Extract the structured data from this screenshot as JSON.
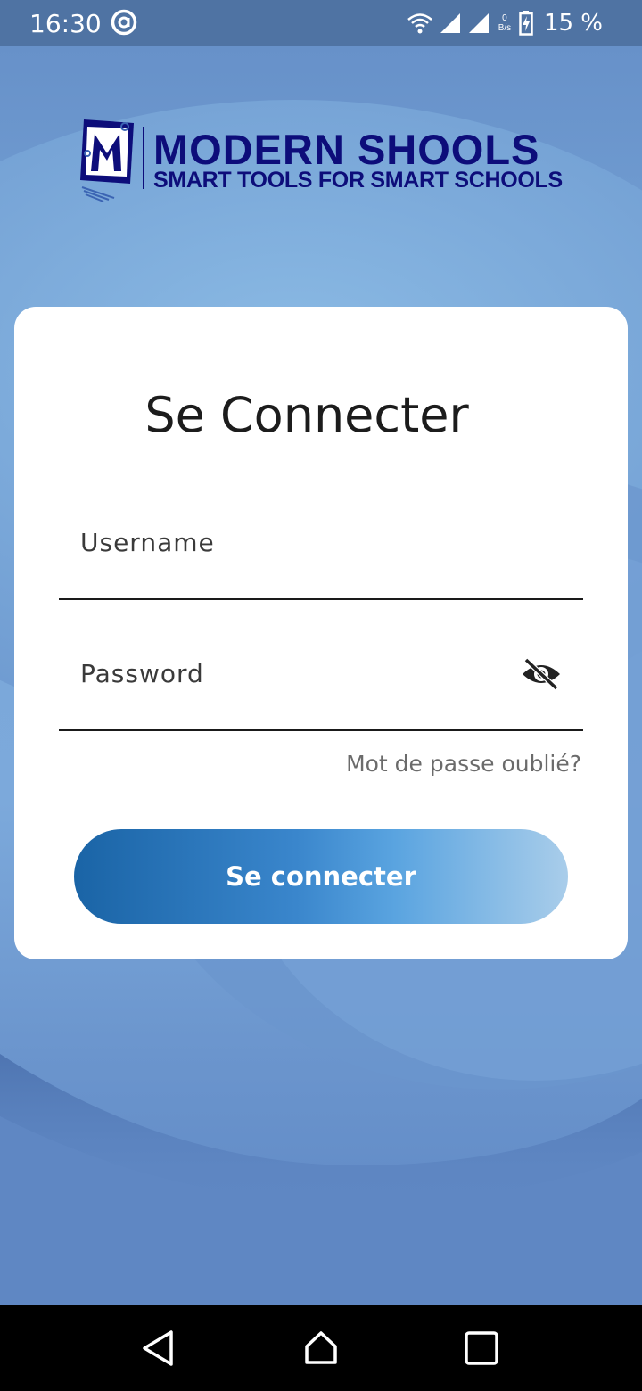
{
  "status_bar": {
    "time": "16:30",
    "net_speed_value": "0",
    "net_speed_unit": "B/s",
    "battery": "15 %",
    "icons": [
      "at-icon",
      "wifi-icon",
      "signal-icon",
      "signal-icon",
      "battery-charging-icon"
    ]
  },
  "logo": {
    "title": "MODERN SHOOLS",
    "subtitle": "SMART TOOLS FOR SMART SCHOOLS"
  },
  "login": {
    "title": "Se Connecter",
    "username_placeholder": "Username",
    "password_placeholder": "Password",
    "forgot_password": "Mot de passe oublié?",
    "submit_label": "Se connecter",
    "visibility_icon": "eye-off-icon"
  },
  "nav": {
    "icons": [
      "back-icon",
      "home-icon",
      "recents-icon"
    ]
  },
  "colors": {
    "status_bar": "#4f73a3",
    "background": "#6b96cd",
    "card": "#ffffff",
    "logo": "#0d0d7a",
    "button_start": "#1a64a6",
    "button_end": "#a9cdea"
  }
}
